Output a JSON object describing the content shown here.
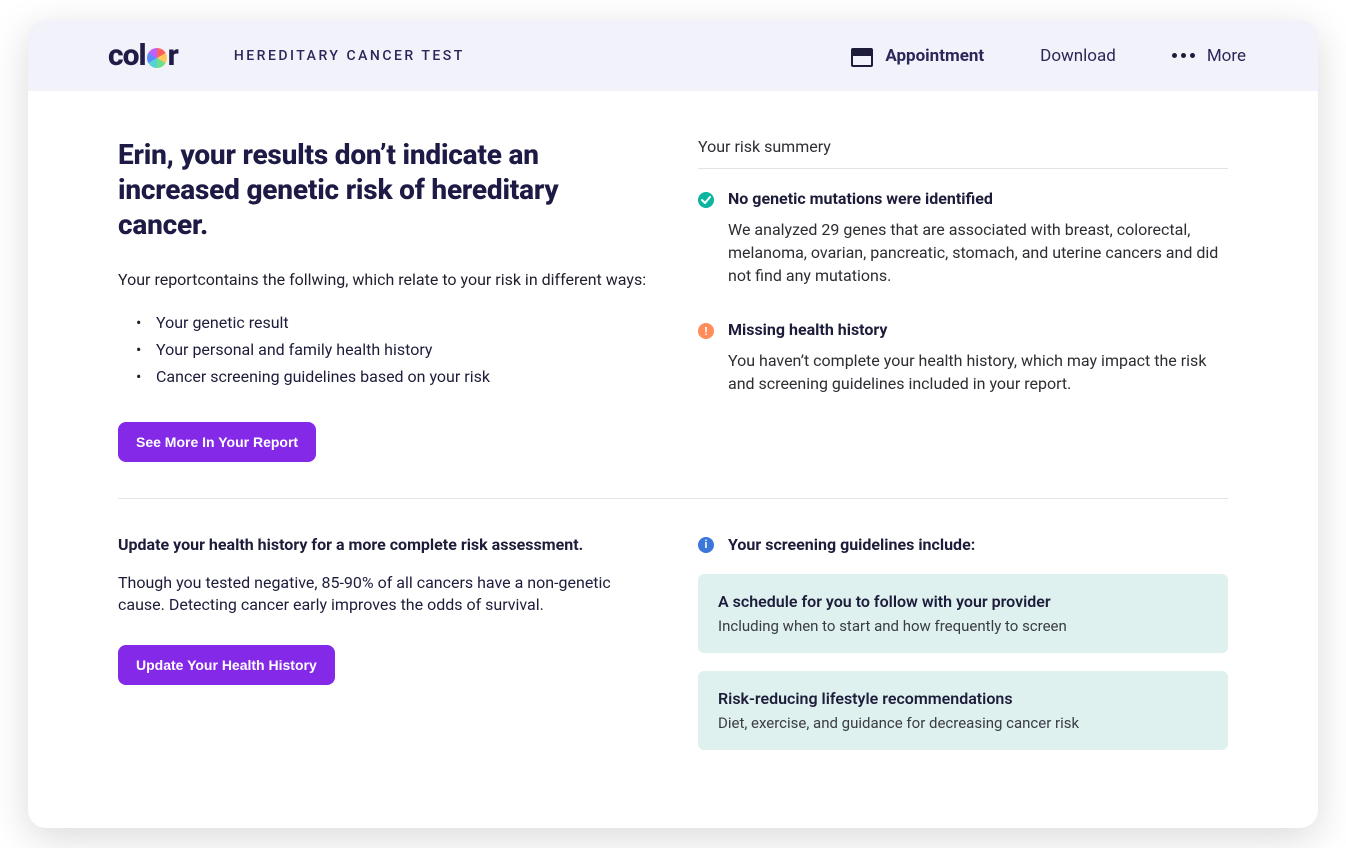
{
  "header": {
    "logo_text_prefix": "col",
    "logo_text_suffix": "r",
    "page_label": "HEREDITARY CANCER TEST",
    "nav": {
      "appointment": "Appointment",
      "download": "Download",
      "more": "More"
    }
  },
  "main": {
    "headline": "Erin, your results don’t indicate an increased genetic risk of hereditary cancer.",
    "intro": "Your reportcontains the follwing, which relate to your risk in different ways:",
    "bullets": [
      "Your genetic result",
      "Your personal and family health history",
      "Cancer screening guidelines based on your risk"
    ],
    "see_more_button": "See More In Your Report"
  },
  "risk_summary": {
    "heading": "Your risk summery",
    "items": [
      {
        "icon": "check",
        "title": "No genetic mutations were identified",
        "body": "We analyzed 29 genes that are associated with breast, colorectal, melanoma, ovarian, pancreatic, stomach, and uterine cancers and did not find any mutations."
      },
      {
        "icon": "warn",
        "title": "Missing health history",
        "body": "You haven’t complete your health history, which may impact the risk and screening guidelines included in your report."
      }
    ]
  },
  "update_section": {
    "heading": "Update your health history for a more complete risk assessment.",
    "body": "Though you tested negative, 85-90% of all cancers have a non-genetic cause. Detecting cancer early improves the odds of survival.",
    "button": "Update Your Health History"
  },
  "guidelines": {
    "heading": "Your screening guidelines include:",
    "cards": [
      {
        "title": "A schedule for you to follow with your provider",
        "sub": "Including when to start and how frequently to screen"
      },
      {
        "title": "Risk-reducing lifestyle recommendations",
        "sub": "Diet, exercise, and guidance for decreasing cancer risk"
      }
    ]
  },
  "colors": {
    "accent_purple": "#8429e8",
    "teal": "#0bb5a0",
    "orange": "#ff8c5a",
    "blue": "#3b77db",
    "card_bg": "#def1ef",
    "header_bg": "#f2f2fa"
  }
}
